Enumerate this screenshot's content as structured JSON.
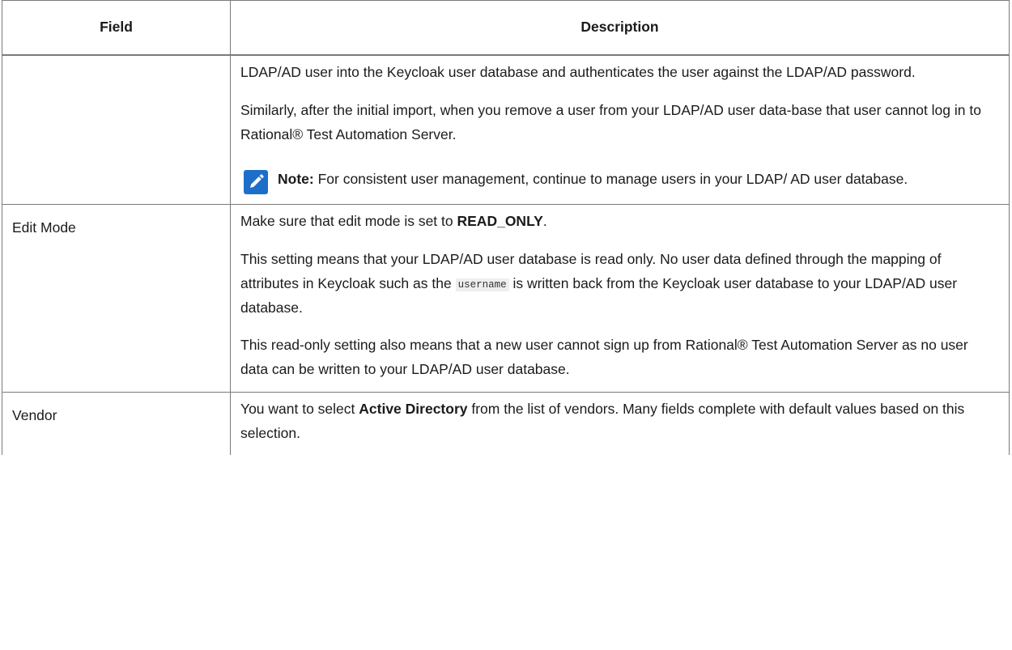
{
  "table": {
    "headers": {
      "field": "Field",
      "description": "Description"
    },
    "rows": [
      {
        "field": "",
        "paragraphs": [
          "LDAP/AD user into the Keycloak user database and authenticates the user against the LDAP/AD password.",
          "Similarly, after the initial import, when you remove a user from your LDAP/AD user data-base that user cannot log in to Rational® Test Automation Server."
        ],
        "note": {
          "label": "Note:",
          "text": " For consistent user management, continue to manage users in your LDAP/ AD user database.",
          "icon": "note-pencil-icon",
          "icon_color": "#1d6ec9"
        }
      },
      {
        "field": "Edit Mode",
        "p1_before": "Make sure that edit mode is set to ",
        "p1_bold": "READ_ONLY",
        "p1_after": ".",
        "p2_before": "This setting means that your LDAP/AD user database is read only. No user data defined through the mapping of attributes in Keycloak such as the ",
        "p2_code": "username",
        "p2_after": " is written back from the Keycloak user database to your LDAP/AD user database.",
        "p3": "This read-only setting also means that a new user cannot sign up from Rational® Test Automation Server as no user data can be written to your LDAP/AD user database."
      },
      {
        "field": "Vendor",
        "p1_before": "You want to select ",
        "p1_bold": "Active Directory",
        "p1_after": " from the list of vendors. Many fields complete with default values based on this selection."
      }
    ]
  }
}
